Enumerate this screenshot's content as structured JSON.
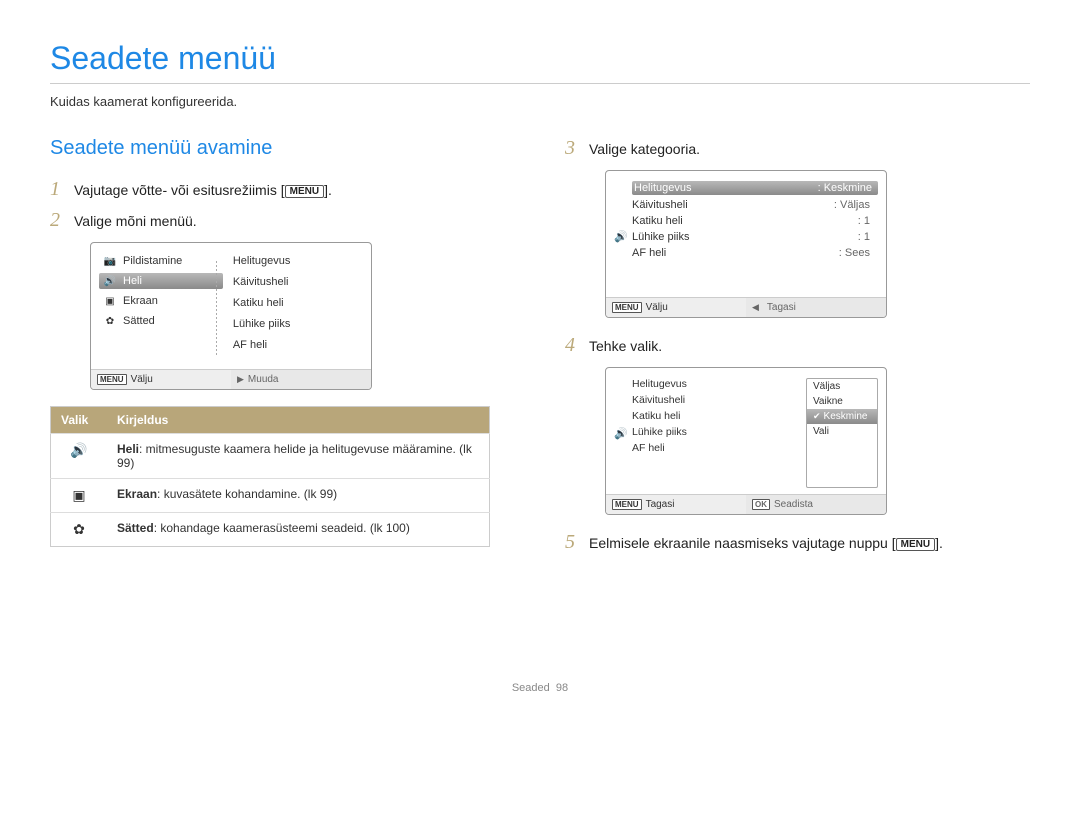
{
  "page": {
    "title": "Seadete menüü",
    "subtitle": "Kuidas kaamerat konfigureerida.",
    "footer_label": "Seaded",
    "footer_page": "98"
  },
  "left": {
    "heading": "Seadete menüü avamine",
    "step1": {
      "num": "1",
      "text_a": "Vajutage võtte- või esitusrežiimis [",
      "badge": "MENU",
      "text_b": "]."
    },
    "step2": {
      "num": "2",
      "text": "Valige mõni menüü."
    },
    "screen1": {
      "left_items": [
        {
          "icon": "camera-icon",
          "glyph": "📷",
          "label": "Pildistamine"
        },
        {
          "icon": "sound-icon",
          "glyph": "🔊",
          "label": "Heli",
          "selected": true
        },
        {
          "icon": "display-icon",
          "glyph": "▣",
          "label": "Ekraan"
        },
        {
          "icon": "gear-icon",
          "glyph": "✿",
          "label": "Sätted"
        }
      ],
      "right_items": [
        "Helitugevus",
        "Käivitusheli",
        "Katiku heli",
        "Lühike piiks",
        "AF heli"
      ],
      "footer_left_badge": "MENU",
      "footer_left": "Välju",
      "footer_right_arrow": "▶",
      "footer_right": "Muuda"
    },
    "table": {
      "col1": "Valik",
      "col2": "Kirjeldus",
      "rows": [
        {
          "glyph": "🔊",
          "label": "Heli",
          "desc": ": mitmesuguste kaamera helide ja helitugevuse määramine. (lk 99)"
        },
        {
          "glyph": "▣",
          "label": "Ekraan",
          "desc": ": kuvasätete kohandamine. (lk 99)"
        },
        {
          "glyph": "✿",
          "label": "Sätted",
          "desc": ": kohandage kaamerasüsteemi seadeid. (lk 100)"
        }
      ]
    }
  },
  "right": {
    "step3": {
      "num": "3",
      "text": "Valige kategooria."
    },
    "screen2": {
      "icon_glyph": "🔊",
      "rows": [
        {
          "k": "Helitugevus",
          "v": "Keskmine",
          "selected": true
        },
        {
          "k": "Käivitusheli",
          "v": "Väljas"
        },
        {
          "k": "Katiku heli",
          "v": "1"
        },
        {
          "k": "Lühike piiks",
          "v": "1"
        },
        {
          "k": "AF heli",
          "v": "Sees"
        }
      ],
      "footer_left_badge": "MENU",
      "footer_left": "Välju",
      "footer_right": "Tagasi"
    },
    "step4": {
      "num": "4",
      "text": "Tehke valik."
    },
    "screen3": {
      "icon_glyph": "🔊",
      "left_items": [
        "Helitugevus",
        "Käivitusheli",
        "Katiku heli",
        "Lühike piiks",
        "AF heli"
      ],
      "options": [
        {
          "label": "Väljas"
        },
        {
          "label": "Vaikne"
        },
        {
          "label": "Keskmine",
          "selected": true,
          "check": true
        },
        {
          "label": "Vali"
        }
      ],
      "footer_left_badge": "MENU",
      "footer_left": "Tagasi",
      "footer_right_badge": "OK",
      "footer_right": "Seadista"
    },
    "step5": {
      "num": "5",
      "text_a": "Eelmisele ekraanile naasmiseks vajutage nuppu [",
      "badge": "MENU",
      "text_b": "]."
    }
  }
}
